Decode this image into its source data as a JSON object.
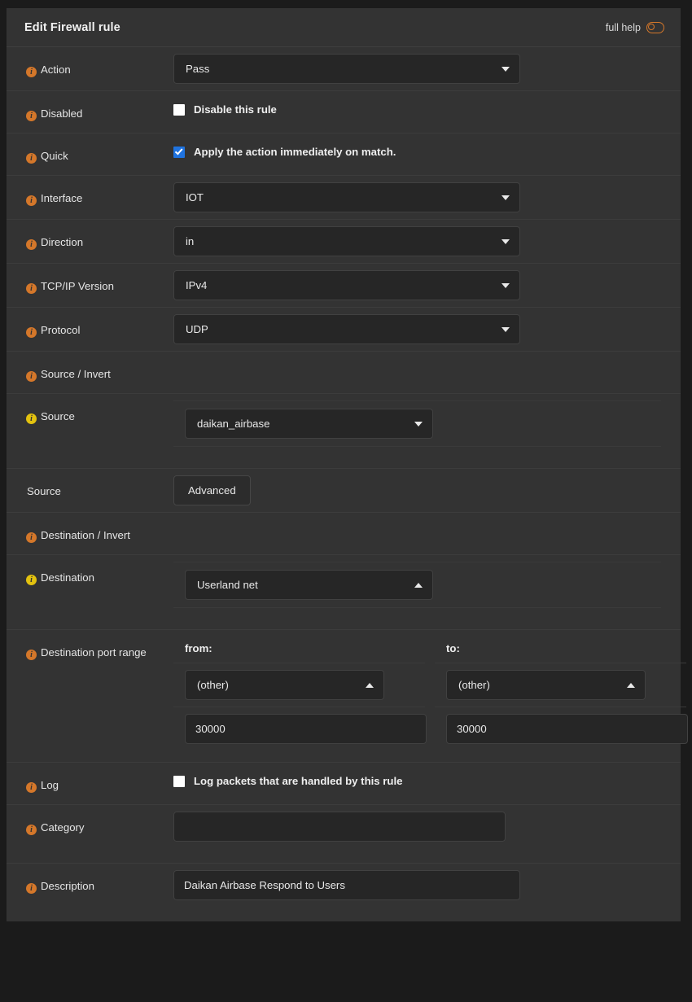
{
  "header": {
    "title": "Edit Firewall rule",
    "help_label": "full help",
    "help_toggle_icon": "toggle-off-icon"
  },
  "colors": {
    "accent_orange": "#d4772a",
    "accent_yellow": "#e3c20f",
    "checkbox_blue": "#1f73e0",
    "panel_bg": "#333333",
    "page_bg": "#1b1b1b",
    "field_bg": "#262626",
    "field_border": "#414141",
    "text": "#e9e9e9"
  },
  "rows": {
    "action": {
      "label": "Action",
      "icon": "info-icon",
      "icon_color": "orange",
      "value": "Pass",
      "arrow": "chevron-down-icon"
    },
    "disabled": {
      "label": "Disabled",
      "icon": "info-icon",
      "icon_color": "orange",
      "checkbox_label": "Disable this rule",
      "checked": false
    },
    "quick": {
      "label": "Quick",
      "icon": "info-icon",
      "icon_color": "orange",
      "checkbox_label": "Apply the action immediately on match.",
      "checked": true
    },
    "interface": {
      "label": "Interface",
      "icon": "info-icon",
      "icon_color": "orange",
      "value": "IOT",
      "arrow": "chevron-down-icon"
    },
    "direction": {
      "label": "Direction",
      "icon": "info-icon",
      "icon_color": "orange",
      "value": "in",
      "arrow": "chevron-down-icon"
    },
    "tcpip_version": {
      "label": "TCP/IP Version",
      "icon": "info-icon",
      "icon_color": "orange",
      "value": "IPv4",
      "arrow": "chevron-down-icon"
    },
    "protocol": {
      "label": "Protocol",
      "icon": "info-icon",
      "icon_color": "orange",
      "value": "UDP",
      "arrow": "chevron-down-icon"
    },
    "source_invert": {
      "label": "Source / Invert",
      "icon": "info-icon",
      "icon_color": "orange",
      "checked": false
    },
    "source": {
      "label": "Source",
      "icon": "info-icon",
      "icon_color": "yellow",
      "value": "daikan_airbase",
      "arrow": "chevron-down-icon"
    },
    "source_advanced": {
      "label": "Source",
      "icon": null,
      "button_label": "Advanced"
    },
    "destination_invert": {
      "label": "Destination / Invert",
      "icon": "info-icon",
      "icon_color": "orange",
      "checked": false
    },
    "destination": {
      "label": "Destination",
      "icon": "info-icon",
      "icon_color": "yellow",
      "value": "Userland net",
      "arrow": "chevron-up-icon"
    },
    "destination_port_range": {
      "label": "Destination port range",
      "icon": "info-icon",
      "icon_color": "orange",
      "from": {
        "heading": "from:",
        "select_value": "(other)",
        "arrow": "chevron-up-icon",
        "input_value": "30000"
      },
      "to": {
        "heading": "to:",
        "select_value": "(other)",
        "arrow": "chevron-up-icon",
        "input_value": "30000"
      }
    },
    "log": {
      "label": "Log",
      "icon": "info-icon",
      "icon_color": "orange",
      "checkbox_label": "Log packets that are handled by this rule",
      "checked": false
    },
    "category": {
      "label": "Category",
      "icon": "info-icon",
      "icon_color": "orange",
      "value": "",
      "placeholder": ""
    },
    "description": {
      "label": "Description",
      "icon": "info-icon",
      "icon_color": "orange",
      "value": "Daikan Airbase Respond to Users",
      "placeholder": ""
    }
  }
}
